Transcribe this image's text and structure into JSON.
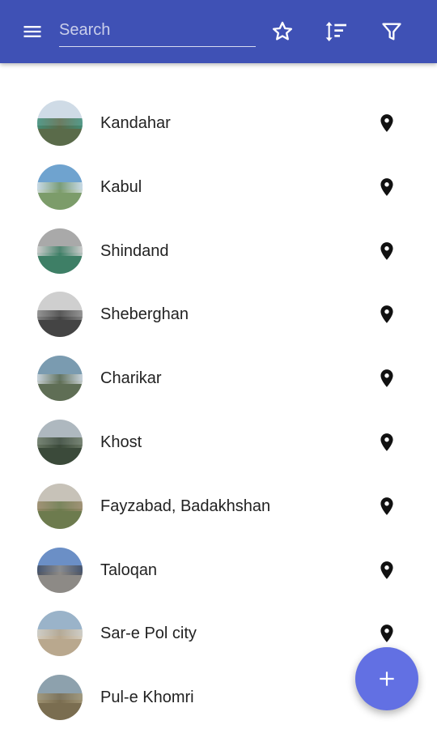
{
  "toolbar": {
    "background": "#3f51b5",
    "menu_icon": "menu-icon",
    "search": {
      "placeholder": "Search",
      "value": ""
    },
    "favorites_icon": "star-outline-icon",
    "sort_icon": "sort-icon",
    "filter_icon": "filter-icon"
  },
  "places": [
    {
      "name": "Kandahar",
      "thumb": [
        "#cfdbe6",
        "#5a6b4a",
        "#3f8f7a"
      ]
    },
    {
      "name": "Kabul",
      "thumb": [
        "#6fa3cf",
        "#7c9c6a",
        "#d9e4ea"
      ]
    },
    {
      "name": "Shindand",
      "thumb": [
        "#a9a9a9",
        "#3e7f66",
        "#d2d2d2"
      ]
    },
    {
      "name": "Sheberghan",
      "thumb": [
        "#cfcfcf",
        "#444444",
        "#8a8a8a"
      ]
    },
    {
      "name": "Charikar",
      "thumb": [
        "#7a9bb0",
        "#5f6e55",
        "#d6dde3"
      ]
    },
    {
      "name": "Khost",
      "thumb": [
        "#aeb8bf",
        "#3b4a3a",
        "#6e7c68"
      ]
    },
    {
      "name": "Fayzabad, Badakhshan",
      "thumb": [
        "#c7c2b8",
        "#6d7b4e",
        "#9a8a6a"
      ]
    },
    {
      "name": "Taloqan",
      "thumb": [
        "#6b8fc6",
        "#8d8a86",
        "#3f4a5e"
      ]
    },
    {
      "name": "Sar-e Pol city",
      "thumb": [
        "#9ab3c9",
        "#b9a88e",
        "#d8d2c6"
      ]
    },
    {
      "name": "Pul-e Khomri",
      "thumb": [
        "#8da1ad",
        "#7a6d50",
        "#a49877"
      ]
    }
  ],
  "row_action_icon": "map-pin-icon",
  "fab": {
    "icon": "plus-icon",
    "color": "#6270e3"
  }
}
